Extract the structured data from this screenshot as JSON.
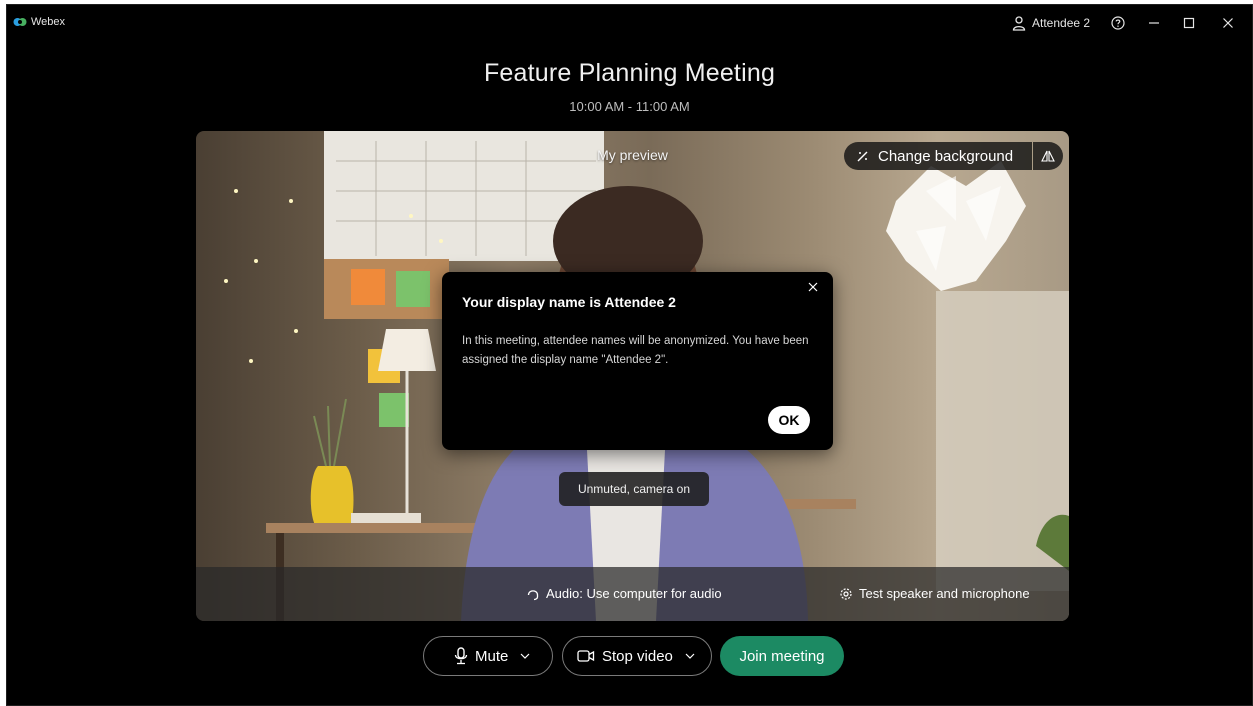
{
  "app": {
    "name": "Webex",
    "logo_icon": "webex-logo-icon"
  },
  "titlebar": {
    "user_name": "Attendee 2",
    "icons": [
      "user-icon",
      "help-icon",
      "minimize-icon",
      "maximize-icon",
      "close-icon"
    ]
  },
  "meeting": {
    "title": "Feature Planning Meeting",
    "time": "10:00 AM - 11:00 AM"
  },
  "preview": {
    "label": "My preview",
    "change_background_label": "Change background",
    "status_toast": "Unmuted, camera on",
    "audio_label": "Audio: Use computer for audio",
    "test_label": "Test speaker and microphone"
  },
  "dialog": {
    "title": "Your display name is Attendee 2",
    "body": "In this meeting, attendee names will be anonymized. You have been assigned the display name \"Attendee 2\".",
    "ok_label": "OK"
  },
  "controls": {
    "mute_label": "Mute",
    "stop_video_label": "Stop video",
    "join_label": "Join meeting",
    "join_color": "#1c8a63"
  }
}
